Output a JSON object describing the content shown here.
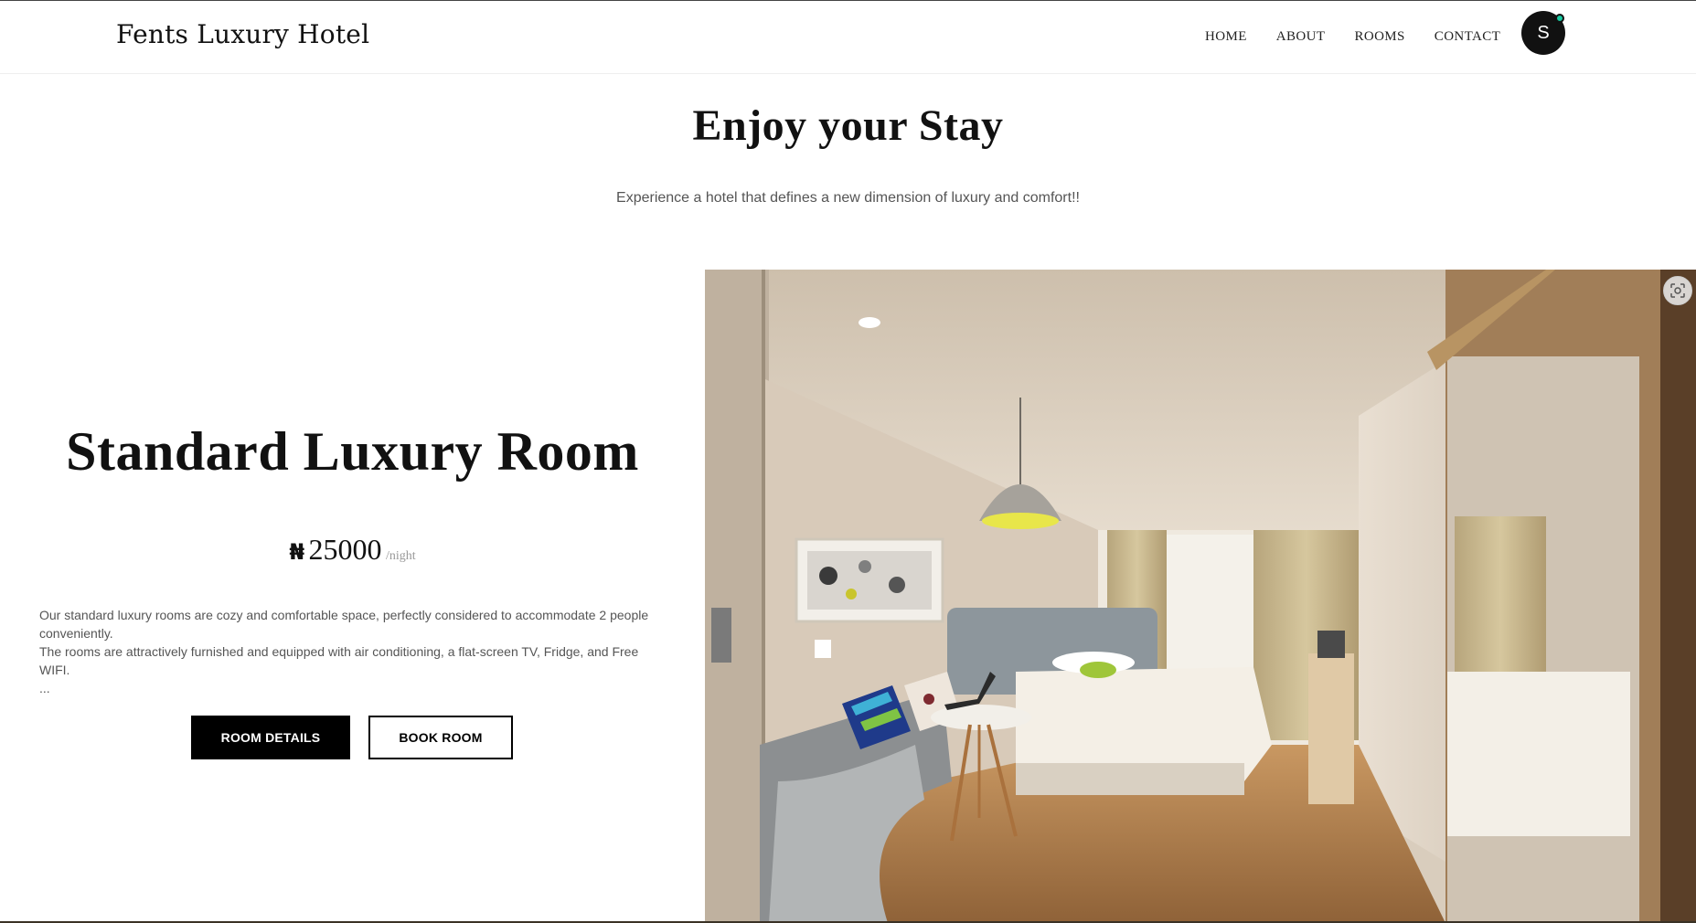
{
  "header": {
    "brand": "Fents Luxury Hotel",
    "nav": [
      {
        "label": "HOME"
      },
      {
        "label": "ABOUT"
      },
      {
        "label": "ROOMS"
      },
      {
        "label": "CONTACT"
      }
    ],
    "avatar_initial": "S",
    "avatar_status_color": "#17c9a1"
  },
  "intro": {
    "title": "Enjoy your Stay",
    "subtitle": "Experience a hotel that defines a new dimension of luxury and comfort!!"
  },
  "room": {
    "name": "Standard Luxury Room",
    "currency_symbol": "₦",
    "price": "25000",
    "price_unit": "/night",
    "description": [
      "Our standard luxury rooms are cozy and comfortable space, perfectly considered to accommodate 2 people conveniently.",
      "The rooms are attractively furnished and equipped with air conditioning, a flat-screen TV, Fridge, and Free WIFI.",
      "..."
    ],
    "details_button": "ROOM DETAILS",
    "book_button": "BOOK ROOM",
    "image_icon": "scan-icon"
  },
  "colors": {
    "primary": "#000000",
    "text_muted": "#555555",
    "status": "#17c9a1"
  }
}
